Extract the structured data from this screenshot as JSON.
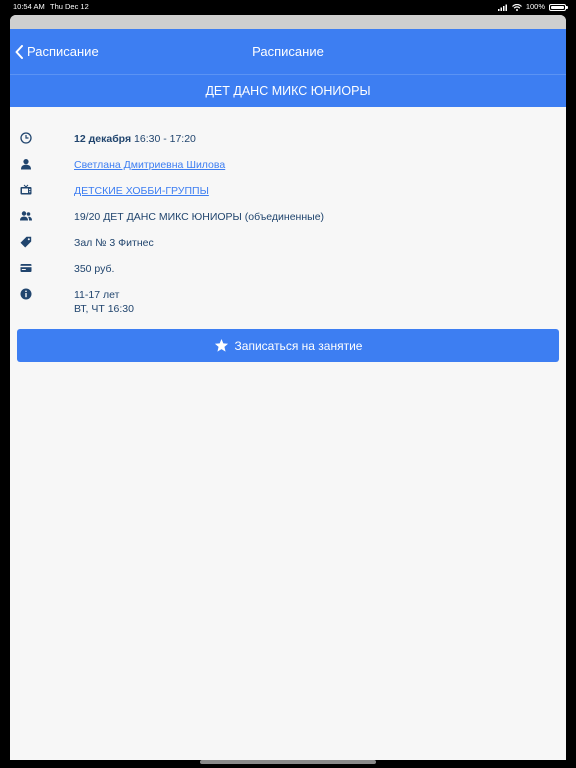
{
  "status_bar": {
    "time": "10:54 AM",
    "date": "Thu Dec 12",
    "battery": "100%",
    "icons": [
      "signal-icon",
      "wifi-icon",
      "battery-icon"
    ]
  },
  "nav": {
    "back_label": "Расписание",
    "title": "Расписание"
  },
  "class_title": "ДЕТ ДАНС МИКС ЮНИОРЫ",
  "details": {
    "date_bold": "12 декабря",
    "time_range": "16:30 - 17:20",
    "instructor": "Светлана Дмитриевна Шилова",
    "category": "ДЕТСКИЕ ХОББИ-ГРУППЫ",
    "group": "19/20 ДЕТ ДАНС МИКС ЮНИОРЫ (объединенные)",
    "hall": "Зал № 3 Фитнес",
    "price": "350 руб.",
    "age": "11-17 лет",
    "days": "ВТ, ЧТ 16:30"
  },
  "signup_button_label": "Записаться на занятие",
  "colors": {
    "accent": "#3d7ef2",
    "text": "#21456e",
    "background": "#f7f7f7"
  }
}
